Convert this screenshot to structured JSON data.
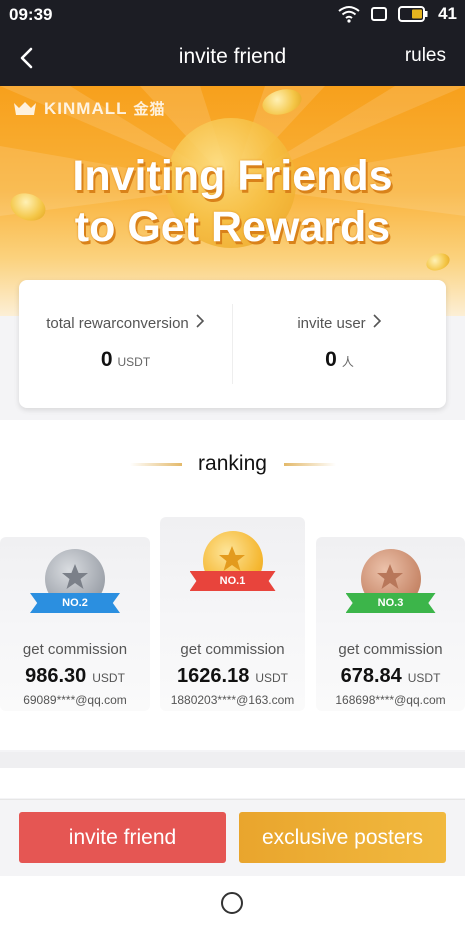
{
  "status_bar": {
    "time": "09:39",
    "battery_level": "41"
  },
  "nav": {
    "title": "invite friend",
    "rules_label": "rules",
    "back_icon": "chevron-left-icon"
  },
  "banner": {
    "brand": "KINMALL",
    "brand_cn": "金猫",
    "title_line1": "Inviting Friends",
    "title_line2": "to Get Rewards"
  },
  "stats": {
    "total_reward": {
      "label": "total rewarconversion",
      "value": "0",
      "unit": "USDT"
    },
    "invite_user": {
      "label": "invite user",
      "value": "0",
      "unit": "人"
    }
  },
  "ranking": {
    "title": "ranking",
    "entries": [
      {
        "rank_label": "NO.2",
        "label": "get commission",
        "amount": "986.30",
        "unit": "USDT",
        "email": "69089****@qq.com",
        "medal_color": "#9ea3ab",
        "ribbon_color": "#2b8fe0"
      },
      {
        "rank_label": "NO.1",
        "label": "get commission",
        "amount": "1626.18",
        "unit": "USDT",
        "email": "1880203****@163.com",
        "medal_color": "#f5b731",
        "ribbon_color": "#e8443c"
      },
      {
        "rank_label": "NO.3",
        "label": "get commission",
        "amount": "678.84",
        "unit": "USDT",
        "email": "168698****@qq.com",
        "medal_color": "#c98a6c",
        "ribbon_color": "#3cb54a"
      }
    ]
  },
  "buttons": {
    "invite": {
      "label": "invite friend",
      "color": "#e55653"
    },
    "posters": {
      "label": "exclusive posters",
      "color": "#eeb038"
    }
  }
}
